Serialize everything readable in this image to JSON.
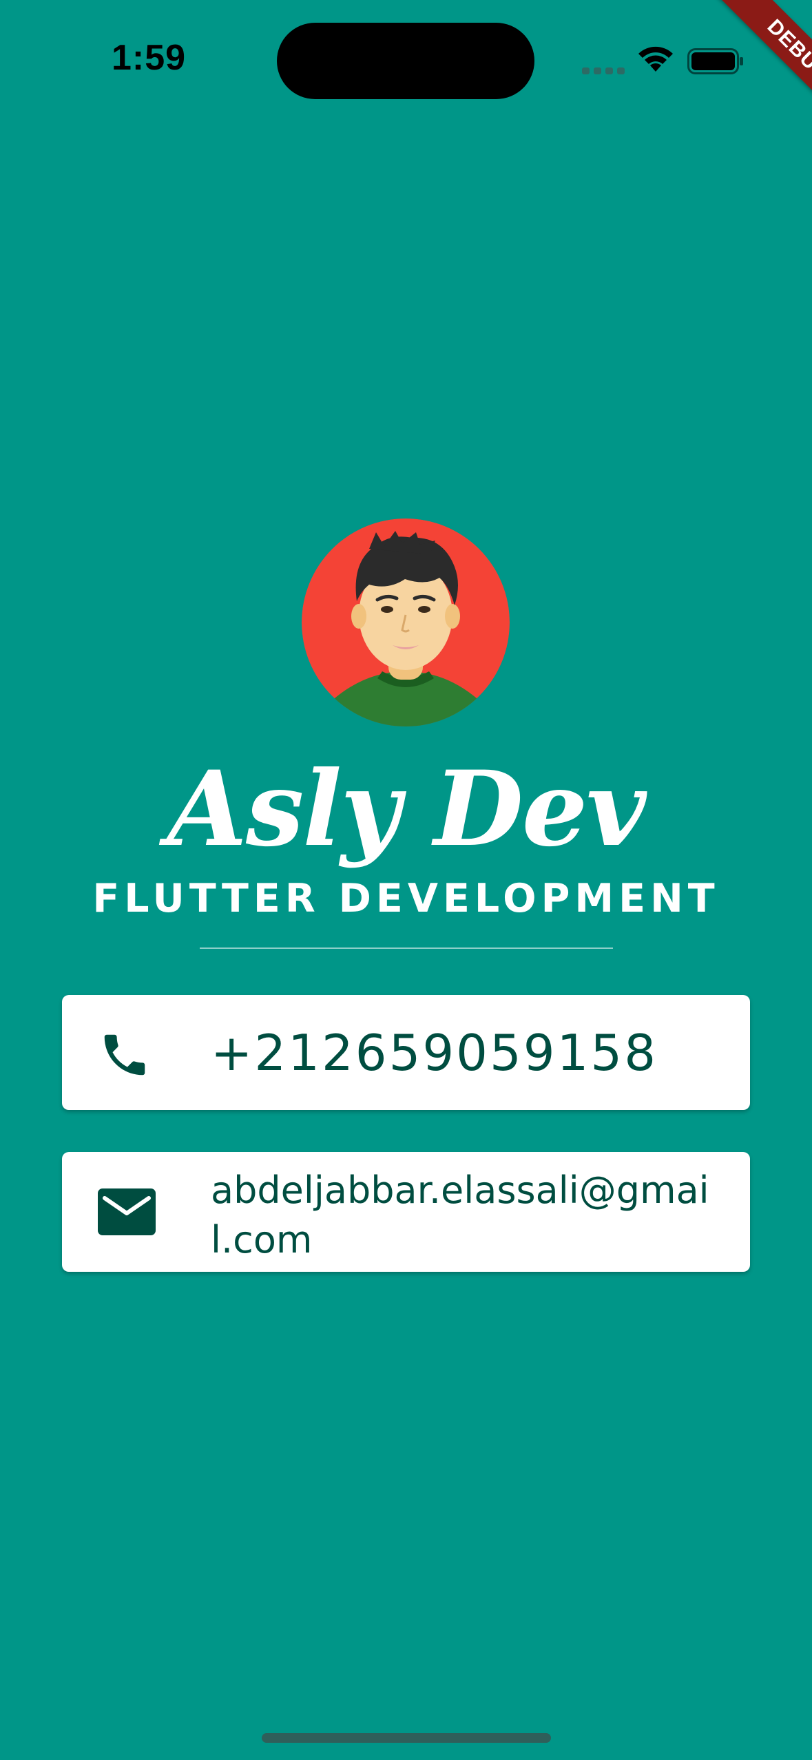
{
  "status_bar": {
    "time": "1:59",
    "icons": [
      "signal-icon",
      "wifi-icon",
      "battery-icon"
    ]
  },
  "debug_banner": {
    "label": "DEBUG",
    "color": "#8b1b16"
  },
  "profile": {
    "name": "Asly Dev",
    "title": "FLUTTER DEVELOPMENT",
    "avatar_bg": "#f44336"
  },
  "contacts": {
    "phone": {
      "icon": "phone-icon",
      "value": "+212659059158"
    },
    "email": {
      "icon": "mail-icon",
      "value": "abdeljabbar.elassali@gmail.com"
    }
  },
  "colors": {
    "background": "#009688",
    "card": "#ffffff",
    "card_text": "#004d40"
  }
}
